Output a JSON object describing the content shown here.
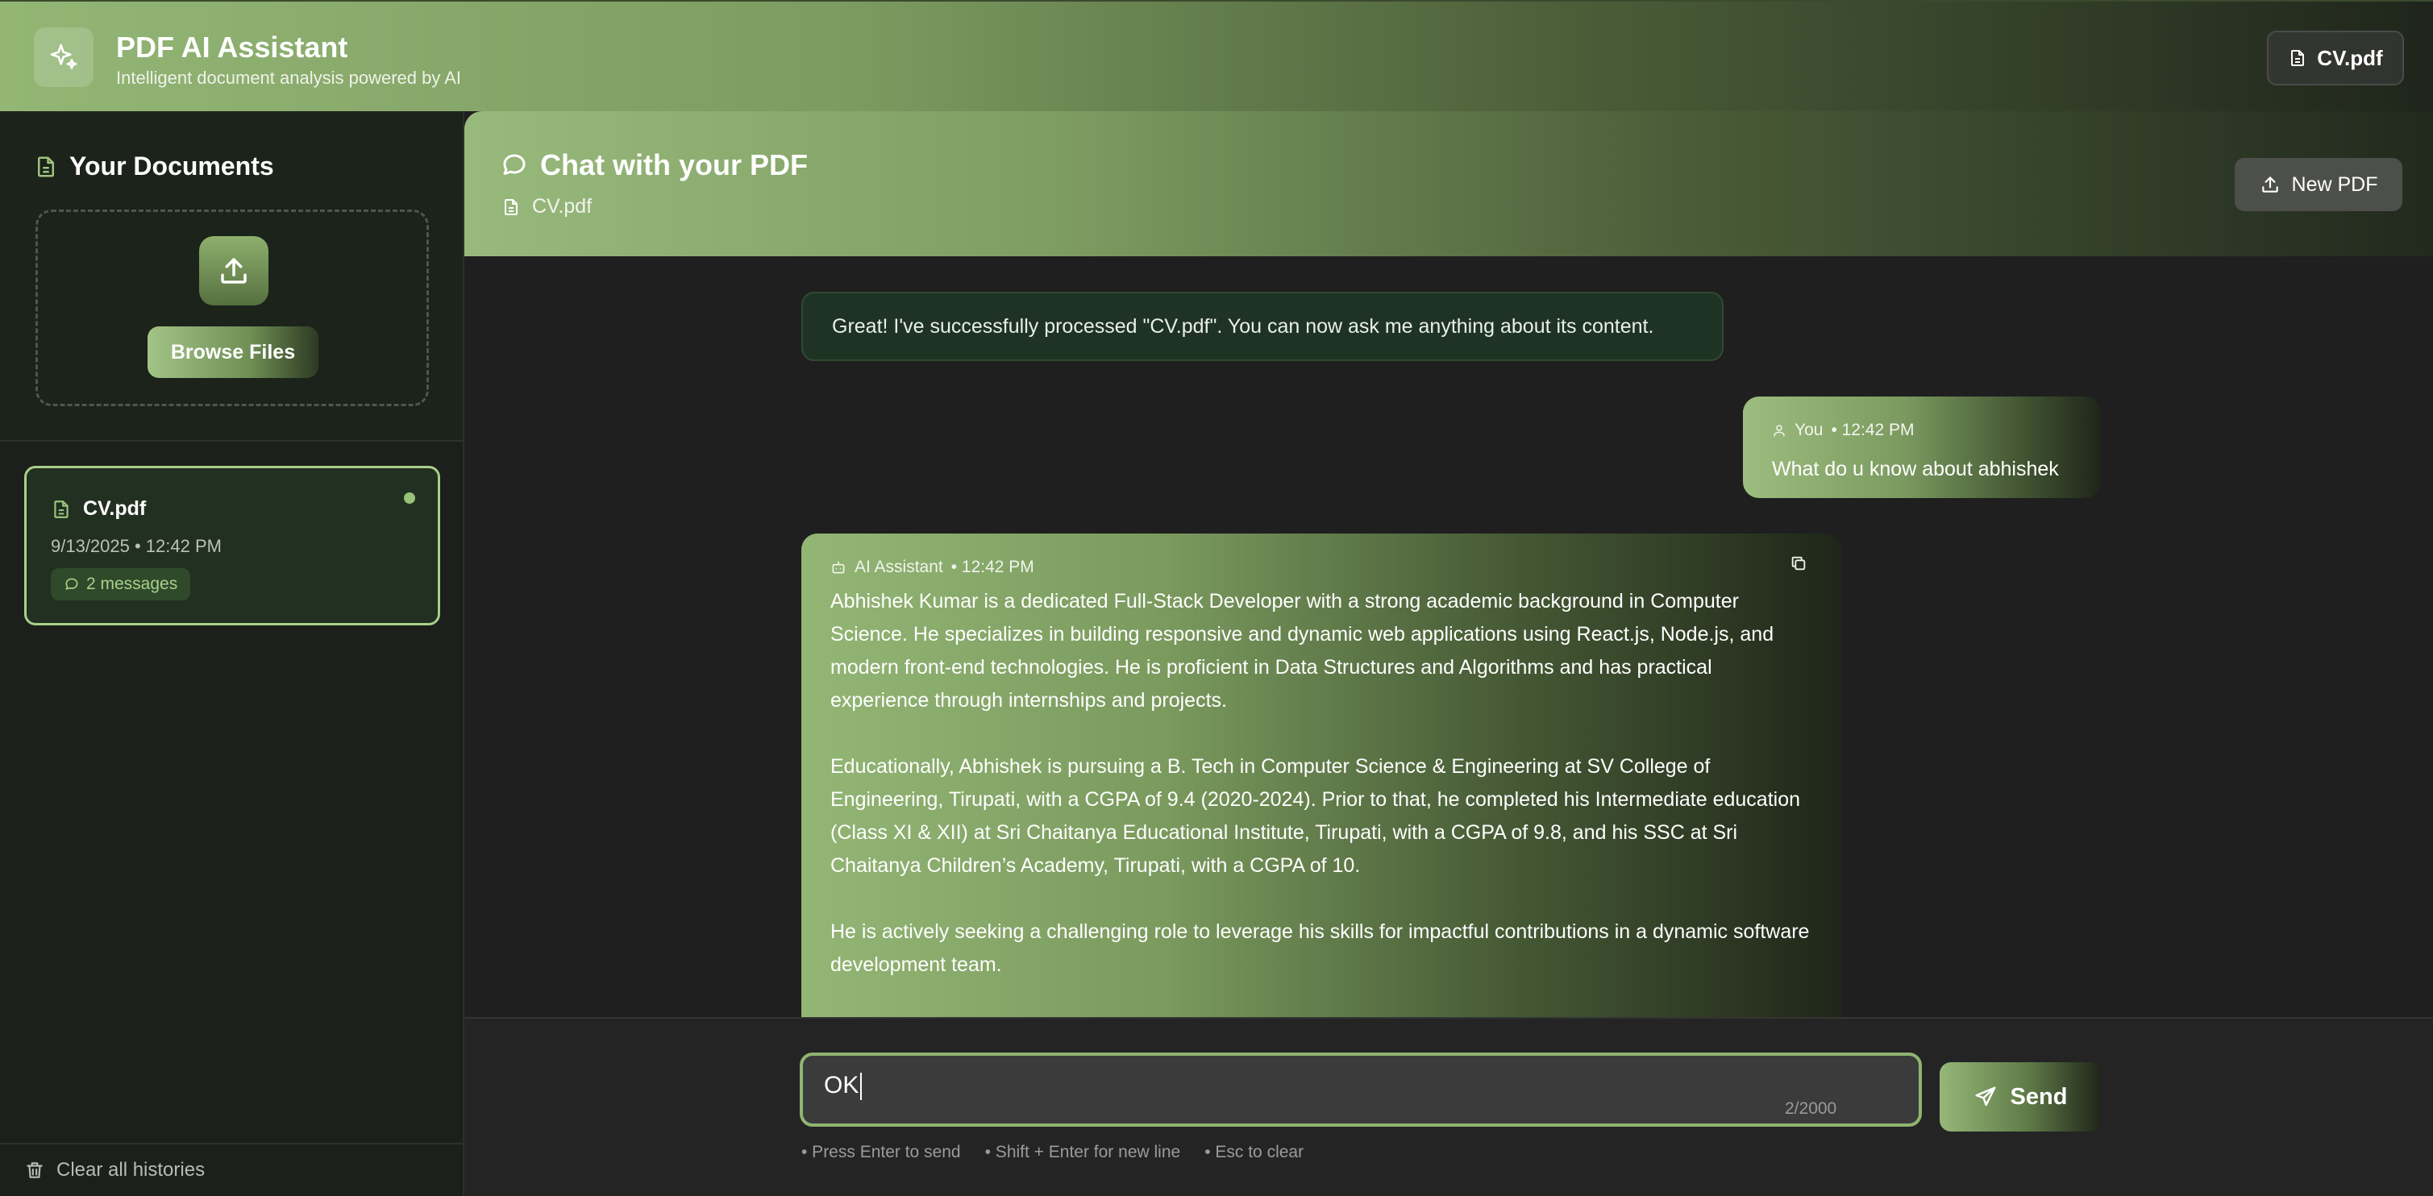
{
  "header": {
    "title": "PDF AI Assistant",
    "subtitle": "Intelligent document analysis powered by AI",
    "current_file": "CV.pdf",
    "logo_icon": "sparkles-icon"
  },
  "sidebar": {
    "heading": "Your Documents",
    "upload_icon": "upload-icon",
    "browse_label": "Browse Files",
    "documents": [
      {
        "name": "CV.pdf",
        "date": "9/13/2025 • 12:42 PM",
        "badge": "2 messages",
        "active": true
      }
    ],
    "clear_label": "Clear all histories"
  },
  "chat": {
    "title": "Chat with your PDF",
    "file": "CV.pdf",
    "new_pdf_label": "New PDF",
    "system_message": "Great! I've successfully processed \"CV.pdf\". You can now ask me anything about its content.",
    "user_message": {
      "author": "You",
      "time": "• 12:42 PM",
      "text": "What do u know about abhishek"
    },
    "ai_message": {
      "author": "AI Assistant",
      "time": "• 12:42 PM",
      "paragraphs": [
        "Abhishek Kumar is a dedicated Full-Stack Developer with a strong academic background in Computer Science. He specializes in building responsive and dynamic web applications using React.js, Node.js, and modern front-end technologies. He is proficient in Data Structures and Algorithms and has practical experience through internships and projects.",
        "Educationally, Abhishek is pursuing a B. Tech in Computer Science & Engineering at SV College of Engineering, Tirupati, with a CGPA of 9.4 (2020-2024). Prior to that, he completed his Intermediate education (Class XI & XII) at Sri Chaitanya Educational Institute, Tirupati, with a CGPA of 9.8, and his SSC at Sri Chaitanya Children’s Academy, Tirupati, with a CGPA of 10.",
        "He is actively seeking a challenging role to leverage his skills for impactful contributions in a dynamic software development team."
      ]
    }
  },
  "composer": {
    "value": "OK",
    "char_count": "2/2000",
    "send_label": "Send",
    "hints": [
      "• Press Enter to send",
      "• Shift + Enter for new line",
      "• Esc to clear"
    ]
  },
  "colors": {
    "accent": "#93b675",
    "accent_dark": "#1f2619",
    "background": "#1e1e1e",
    "active_border": "#a9cf8a"
  }
}
